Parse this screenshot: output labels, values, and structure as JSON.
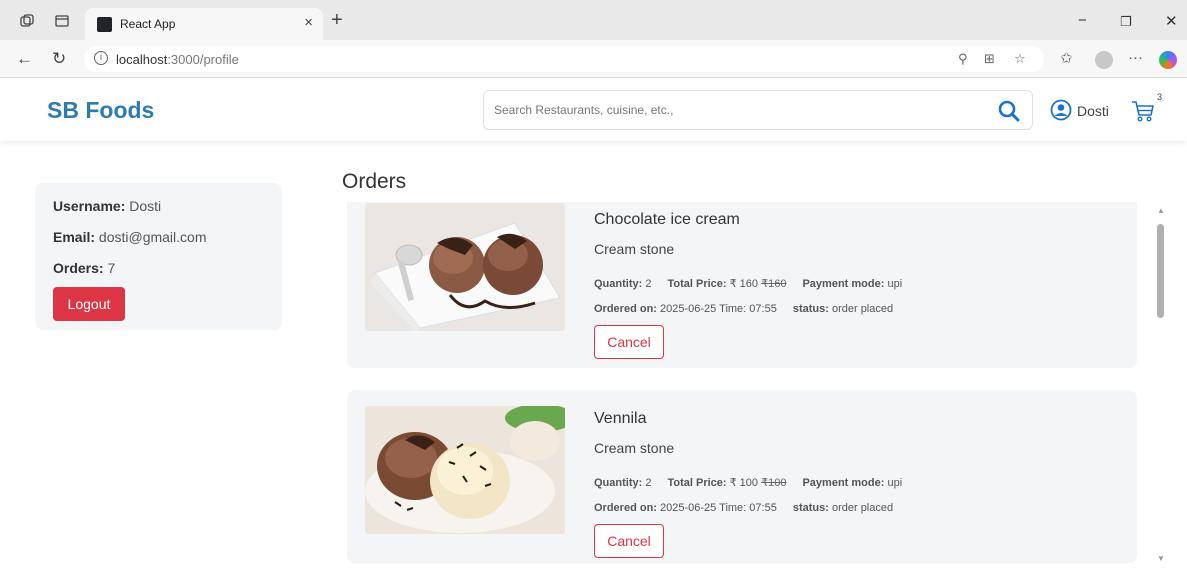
{
  "browser": {
    "tab_title": "React App",
    "tab_close": "×",
    "new_tab": "+",
    "url_prefix": "localhost",
    "url_suffix": ":3000/profile",
    "win_min": "−",
    "win_restore": "❐",
    "win_close": "✕"
  },
  "navbar": {
    "brand": "SB Foods",
    "search_placeholder": "Search Restaurants, cuisine, etc.,",
    "username": "Dosti",
    "cart_count": "3"
  },
  "profile": {
    "username_label": "Username:",
    "username": "Dosti",
    "email_label": "Email:",
    "email": "dosti@gmail.com",
    "orders_label": "Orders:",
    "orders": "7",
    "logout_label": "Logout"
  },
  "orders_title": "Orders",
  "orders": [
    {
      "name": "Chocolate ice cream",
      "restaurant": "Cream stone",
      "quantity_label": "Quantity:",
      "quantity": "2",
      "total_label": "Total Price:",
      "price": "₹ 160",
      "original_price": "₹160",
      "payment_label": "Payment mode:",
      "payment": "upi",
      "ordered_label": "Ordered on:",
      "ordered": "2025-06-25 Time: 07:55",
      "status_label": "status:",
      "status": "order placed",
      "cancel_label": "Cancel"
    },
    {
      "name": "Vennila",
      "restaurant": "Cream stone",
      "quantity_label": "Quantity:",
      "quantity": "2",
      "total_label": "Total Price:",
      "price": "₹ 100",
      "original_price": "₹100",
      "payment_label": "Payment mode:",
      "payment": "upi",
      "ordered_label": "Ordered on:",
      "ordered": "2025-06-25 Time: 07:55",
      "status_label": "status:",
      "status": "order placed",
      "cancel_label": "Cancel"
    }
  ],
  "colors": {
    "brand": "#2e7cab",
    "danger": "#dc3545",
    "card_bg": "#f4f5f6"
  }
}
